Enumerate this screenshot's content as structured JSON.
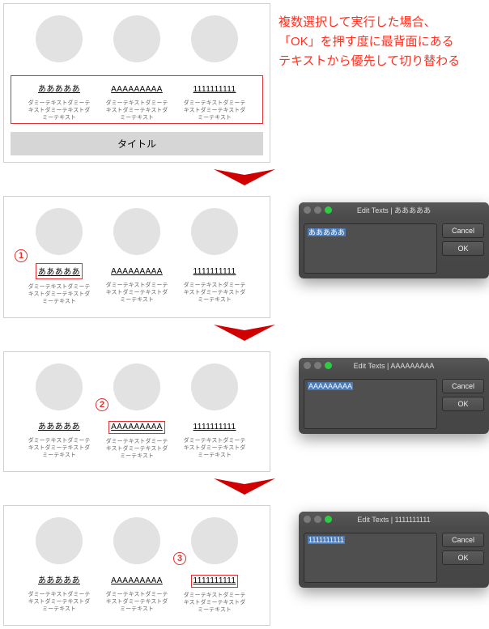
{
  "note": "複数選択して実行した場合、\n「OK」を押す度に最背面にある\nテキストから優先して切り替わる",
  "cols": {
    "a": {
      "head": "あああああ",
      "sub": "ダミーテキストダミーテキストダミーテキストダミーテキスト"
    },
    "b": {
      "head": "AAAAAAAAA",
      "sub": "ダミーテキストダミーテキストダミーテキストダミーテキスト"
    },
    "c": {
      "head": "1111111111",
      "sub": "ダミーテキストダミーテキストダミーテキストダミーテキスト"
    }
  },
  "titlebar": "タイトル",
  "steps": [
    {
      "num": "1",
      "sel": "a",
      "dlg_title": "Edit Texts | あああああ",
      "dlg_val": "あああああ"
    },
    {
      "num": "2",
      "sel": "b",
      "dlg_title": "Edit Texts | AAAAAAAAA",
      "dlg_val": "AAAAAAAAA"
    },
    {
      "num": "3",
      "sel": "c",
      "dlg_title": "Edit Texts | 1111111111",
      "dlg_val": "1111111111"
    }
  ],
  "btn": {
    "cancel": "Cancel",
    "ok": "OK"
  }
}
